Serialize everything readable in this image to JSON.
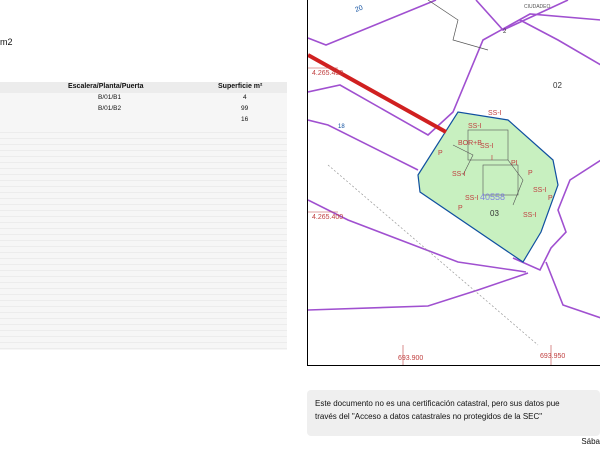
{
  "header": {
    "unit_fragment": "m2"
  },
  "table": {
    "columns": [
      "Escalera/Planta/Puerta",
      "Superficie m²"
    ],
    "rows": [
      {
        "location": "B/01/B1",
        "surface": "4"
      },
      {
        "location": "B/01/B2",
        "surface": "99"
      },
      {
        "location": "",
        "surface": "16"
      }
    ]
  },
  "map": {
    "y_coord_top": "4.265.450",
    "y_coord_bottom": "4.265.400",
    "x_coord_left": "693.900",
    "x_coord_right": "693.950",
    "parcel_02": "02",
    "parcel_03": "03",
    "parcel_ref": "40558",
    "street_number_a": "20",
    "street_number_b": "2",
    "street_number_c": "18",
    "street_name_fragment": "CIUDADEO",
    "subparcel_ssi": "SS-I",
    "subparcel_p": "P",
    "subparcel_bor": "BOR+B",
    "subparcel_pi": "PI",
    "subparcel_i": "I",
    "colors": {
      "boundary": "#a050d0",
      "parcel_fill": "#c8f0c0",
      "parcel_edge": "#1050a0",
      "pointer": "#d02020",
      "labels": "#c04040"
    }
  },
  "footer": {
    "note_line1": "Este documento no es una certificación catastral, pero sus datos pue",
    "note_line2": "través del \"Acceso a datos catastrales no protegidos de la SEC\"",
    "date_fragment": "Sába"
  }
}
